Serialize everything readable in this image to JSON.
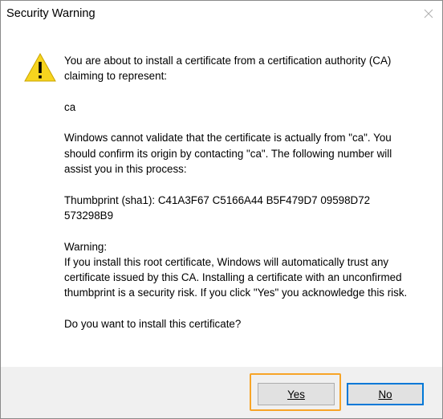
{
  "window": {
    "title": "Security Warning",
    "close_icon": "close-icon"
  },
  "icon": {
    "name": "warning-icon",
    "color": "#f7d41e"
  },
  "message": {
    "intro": "You are about to install a certificate from a certification authority (CA) claiming to represent:",
    "subject": "ca",
    "validation": "Windows cannot validate that the certificate is actually from \"ca\". You should confirm its origin by contacting \"ca\". The following number will assist you in this process:",
    "thumbprint": "Thumbprint (sha1): C41A3F67 C5166A44 B5F479D7 09598D72 573298B9",
    "warning_heading": "Warning:",
    "warning_body": "If you install this root certificate, Windows will automatically trust any certificate issued by this CA. Installing a certificate with an unconfirmed thumbprint is a security risk. If you click \"Yes\" you acknowledge this risk.",
    "question": "Do you want to install this certificate?"
  },
  "buttons": {
    "yes_label": "Yes",
    "no_label": "No"
  },
  "colors": {
    "focus_highlight": "#f7a427",
    "default_button_border": "#0078d7",
    "footer_bg": "#f0f0f0"
  }
}
